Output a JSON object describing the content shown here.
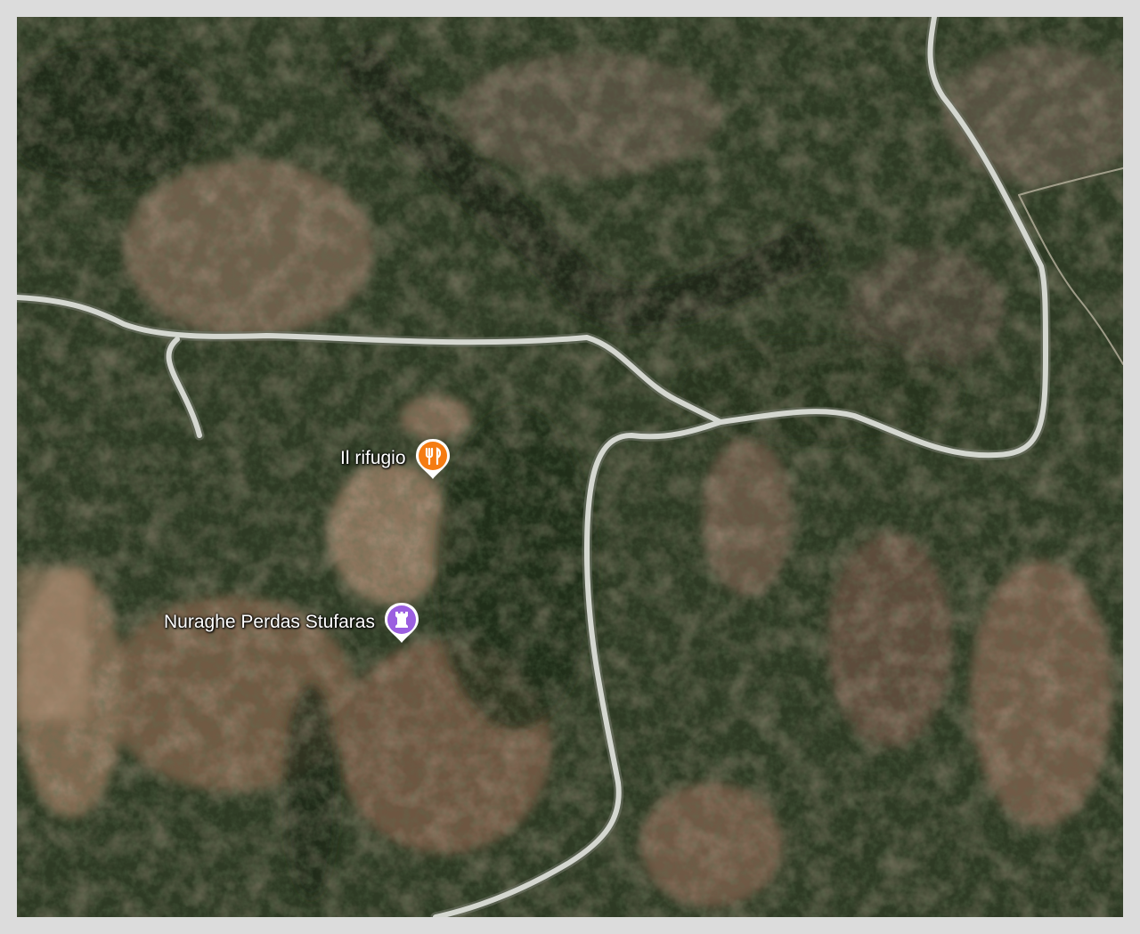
{
  "map": {
    "view": "satellite",
    "places": [
      {
        "label": "Il rifugio",
        "icon": "restaurant-icon",
        "color": "#f57c12"
      },
      {
        "label": "Nuraghe Perdas Stufaras",
        "icon": "tower-icon",
        "color": "#9b5fe0"
      }
    ]
  }
}
